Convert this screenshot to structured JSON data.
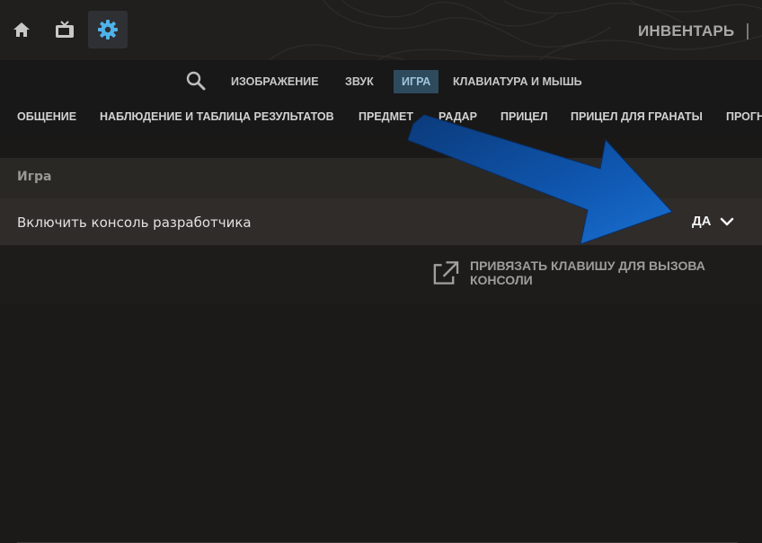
{
  "top_nav": {
    "icons": [
      "home-icon",
      "tv-icon",
      "gear-icon"
    ],
    "active": "gear-icon",
    "inventory_label": "ИНВЕНТАРЬ"
  },
  "settings_tabs": [
    {
      "label": "ИЗОБРАЖЕНИЕ",
      "active": false
    },
    {
      "label": "ЗВУК",
      "active": false
    },
    {
      "label": "ИГРА",
      "active": true
    },
    {
      "label": "КЛАВИАТУРА И МЫШЬ",
      "active": false
    }
  ],
  "sub_tabs": [
    "ОБЩЕНИЕ",
    "НАБЛЮДЕНИЕ И ТАБЛИЦА РЕЗУЛЬТАТОВ",
    "ПРЕДМЕТ",
    "РАДАР",
    "ПРИЦЕЛ",
    "ПРИЦЕЛ ДЛЯ ГРАНАТЫ",
    "ПРОГН"
  ],
  "section": {
    "title": "Игра",
    "setting_label": "Включить консоль разработчика",
    "setting_value": "ДА"
  },
  "bind_console": {
    "label": "ПРИВЯЗАТЬ КЛАВИШУ ДЛЯ ВЫЗОВА КОНСОЛИ",
    "icon": "external-link-icon"
  },
  "colors": {
    "active_tab_bg": "#2e4b5d",
    "active_icon": "#4fb3ea",
    "arrow": "#1565c0"
  }
}
